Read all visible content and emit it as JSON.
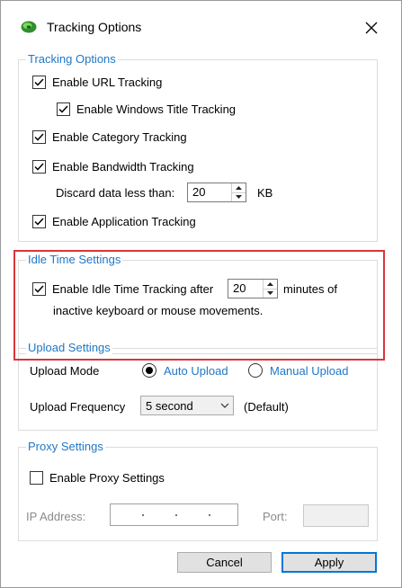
{
  "window": {
    "title": "Tracking Options"
  },
  "tracking": {
    "legend": "Tracking Options",
    "url": {
      "label": "Enable URL Tracking",
      "checked": true
    },
    "windows_title": {
      "label": "Enable Windows Title Tracking",
      "checked": true
    },
    "category": {
      "label": "Enable Category Tracking",
      "checked": true
    },
    "bandwidth": {
      "label": "Enable Bandwidth Tracking",
      "checked": true
    },
    "discard": {
      "label": "Discard data less than:",
      "value": "20",
      "unit": "KB"
    },
    "application": {
      "label": "Enable Application Tracking",
      "checked": true
    }
  },
  "idle": {
    "legend": "Idle Time Settings",
    "checkbox_label": "Enable Idle Time Tracking after",
    "checked": true,
    "minutes_value": "20",
    "suffix": "minutes of",
    "line2": "inactive keyboard or mouse movements."
  },
  "upload": {
    "legend": "Upload Settings",
    "mode_label": "Upload Mode",
    "auto_label": "Auto Upload",
    "manual_label": "Manual Upload",
    "selected": "auto",
    "frequency_label": "Upload Frequency",
    "frequency_value": "5 second",
    "default_note": "(Default)"
  },
  "proxy": {
    "legend": "Proxy Settings",
    "enable_label": "Enable Proxy Settings",
    "checked": false,
    "ip_label": "IP Address:",
    "port_label": "Port:"
  },
  "buttons": {
    "cancel": "Cancel",
    "apply": "Apply"
  },
  "colors": {
    "accent": "#1f77c6",
    "highlight": "#d9363b",
    "default_button": "#0078d7"
  }
}
